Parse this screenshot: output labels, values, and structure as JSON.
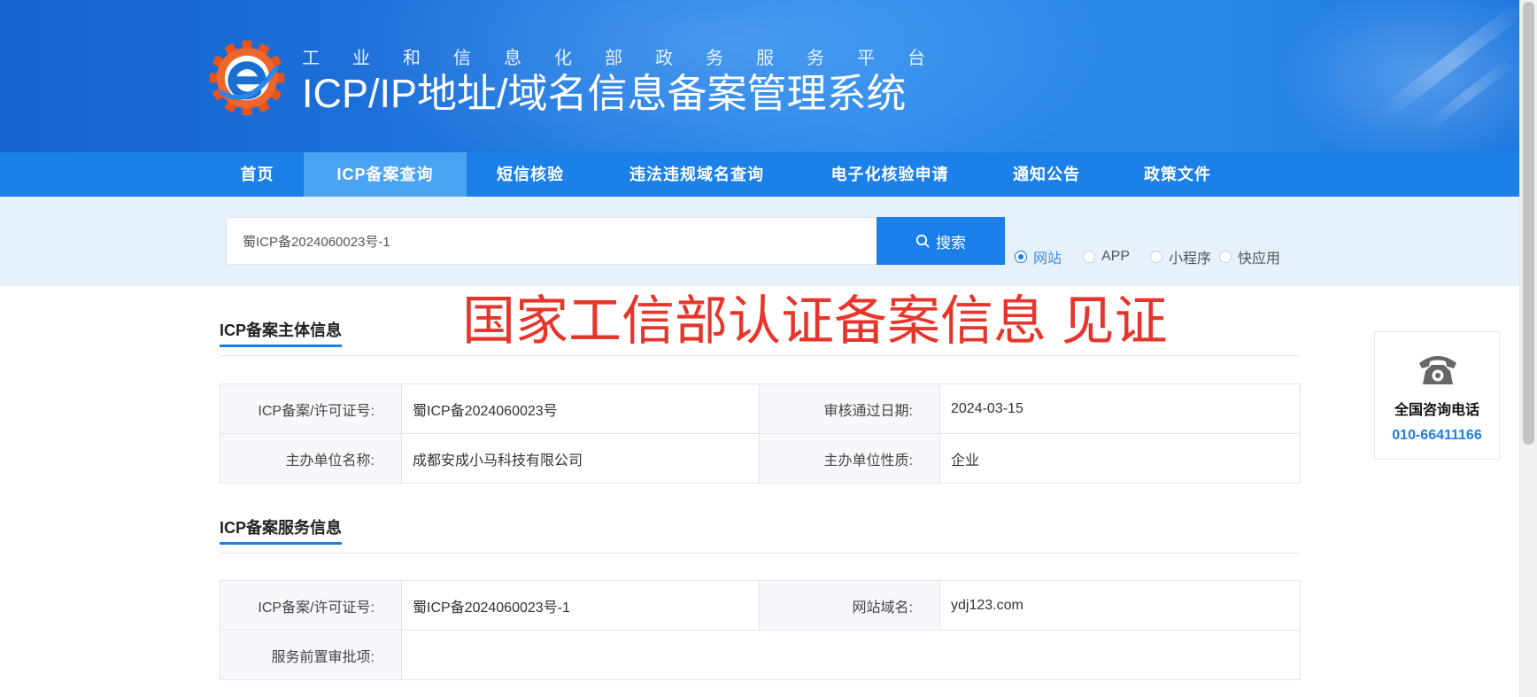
{
  "header": {
    "logo_icon": "miit-gear-logo-icon",
    "subtitle": "工业和信息化部政务服务平台",
    "title": "ICP/IP地址/域名信息备案管理系统"
  },
  "nav": {
    "items": [
      {
        "label": "首页",
        "active": false
      },
      {
        "label": "ICP备案查询",
        "active": true
      },
      {
        "label": "短信核验",
        "active": false
      },
      {
        "label": "违法违规域名查询",
        "active": false
      },
      {
        "label": "电子化核验申请",
        "active": false
      },
      {
        "label": "通知公告",
        "active": false
      },
      {
        "label": "政策文件",
        "active": false
      }
    ]
  },
  "search": {
    "value": "蜀ICP备2024060023号-1",
    "button_label": "搜索",
    "button_icon": "search-icon",
    "types": [
      {
        "label": "网站",
        "selected": true
      },
      {
        "label": "APP",
        "selected": false
      },
      {
        "label": "小程序",
        "selected": false
      },
      {
        "label": "快应用",
        "selected": false
      }
    ]
  },
  "overlay_caption": "国家工信部认证备案信息 见证",
  "subject_info": {
    "title": "ICP备案主体信息",
    "rows": [
      [
        "ICP备案/许可证号:",
        "蜀ICP备2024060023号",
        "审核通过日期:",
        "2024-03-15"
      ],
      [
        "主办单位名称:",
        "成都安成小马科技有限公司",
        "主办单位性质:",
        "企业"
      ]
    ]
  },
  "service_info": {
    "title": "ICP备案服务信息",
    "rows": [
      [
        "ICP备案/许可证号:",
        "蜀ICP备2024060023号-1",
        "网站域名:",
        "ydj123.com"
      ],
      [
        "服务前置审批项:",
        ""
      ]
    ]
  },
  "hotline": {
    "icon": "telephone-icon",
    "label": "全国咨询电话",
    "number": "010-66411166"
  },
  "colors": {
    "header_blue": "#1e72db",
    "nav_blue": "#1b80e8",
    "nav_active": "#4aa3f3",
    "search_band": "#e7f1fc",
    "primary": "#1a7fe8",
    "overlay_red": "#e6362c"
  }
}
